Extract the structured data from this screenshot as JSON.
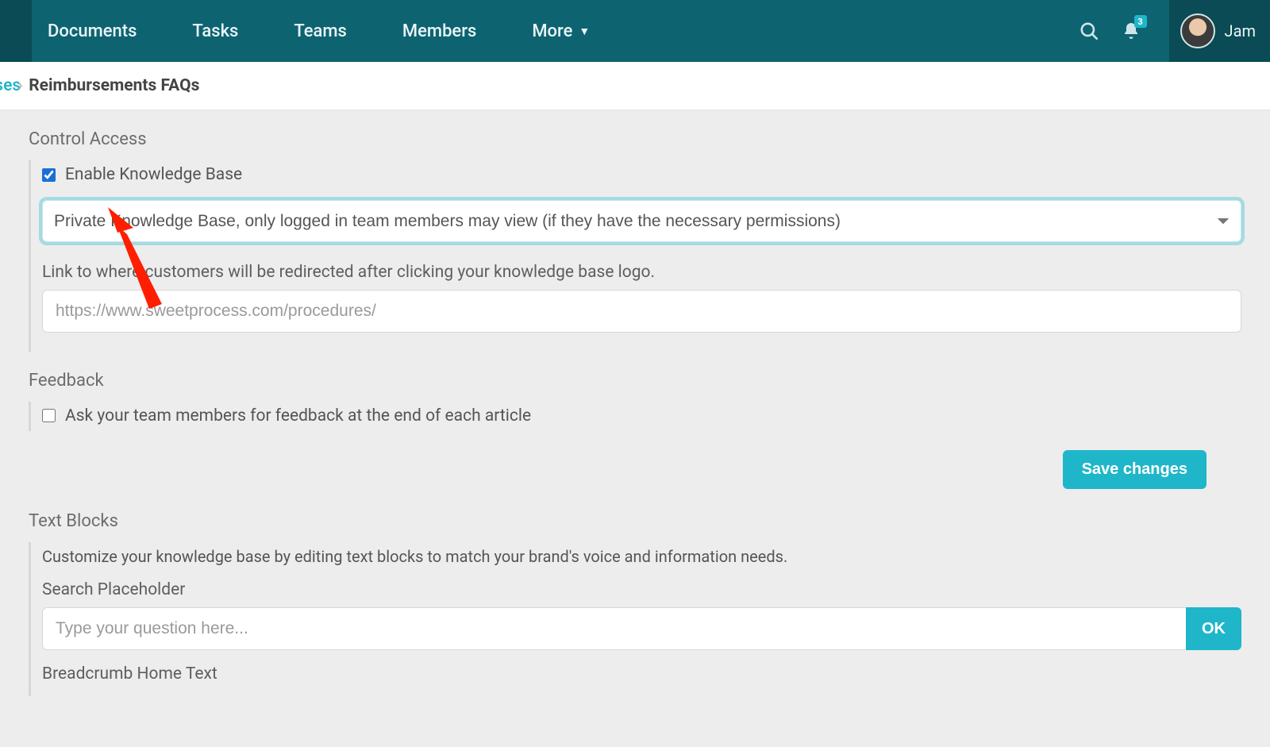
{
  "nav": {
    "items": [
      "Documents",
      "Tasks",
      "Teams",
      "Members"
    ],
    "more": "More",
    "notif_count": "3",
    "username": "Jam"
  },
  "breadcrumb": {
    "prev": "ases",
    "current": "Reimbursements FAQs"
  },
  "sections": {
    "control_access": {
      "title": "Control Access",
      "enable_kb": "Enable Knowledge Base",
      "privacy_option": "Private Knowledge Base, only logged in team members may view (if they have the necessary permissions)",
      "redirect_help": "Link to where customers will be redirected after clicking your knowledge base logo.",
      "redirect_placeholder": "https://www.sweetprocess.com/procedures/"
    },
    "feedback": {
      "title": "Feedback",
      "ask": "Ask your team members for feedback at the end of each article"
    },
    "save_label": "Save changes",
    "text_blocks": {
      "title": "Text Blocks",
      "blurb": "Customize your knowledge base by editing text blocks to match your brand's voice and information needs.",
      "search_label": "Search Placeholder",
      "search_placeholder": "Type your question here...",
      "ok": "OK",
      "breadcrumb_label": "Breadcrumb Home Text"
    }
  }
}
